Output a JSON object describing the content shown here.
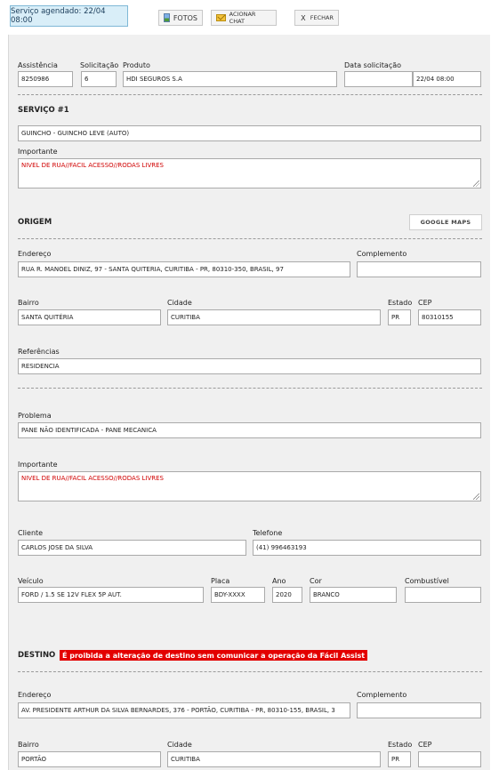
{
  "header": {
    "status": "Serviço agendado: 22/04 08:00",
    "fotos_label": "FOTOS",
    "chat_label": "ACIONAR CHAT",
    "fechar_label": "FECHAR",
    "fechar_glyph": "X"
  },
  "summary": {
    "assistencia_label": "Assistência",
    "assistencia_value": "8250986",
    "solicitacao_label": "Solicitação",
    "solicitacao_value": "6",
    "produto_label": "Produto",
    "produto_value": "HDI SEGUROS S.A",
    "data_label": "Data solicitação",
    "data_value_1": "",
    "data_value_2": "22/04 08:00"
  },
  "servico": {
    "title": "SERVIÇO #1",
    "tipo_value": "GUINCHO - GUINCHO LEVE (AUTO)",
    "importante_label": "Importante",
    "importante_value": "NIVEL DE RUA//FACIL ACESSO//RODAS LIVRES"
  },
  "origem": {
    "title": "ORIGEM",
    "maps_label": "GOOGLE MAPS",
    "endereco_label": "Endereço",
    "endereco_value": "RUA R. MANOEL DINIZ, 97 - SANTA QUITERIA, CURITIBA - PR, 80310-350, BRASIL, 97",
    "complemento_label": "Complemento",
    "complemento_value": "",
    "bairro_label": "Bairro",
    "bairro_value": "SANTA QUITÉRIA",
    "cidade_label": "Cidade",
    "cidade_value": "CURITIBA",
    "estado_label": "Estado",
    "estado_value": "PR",
    "cep_label": "CEP",
    "cep_value": "80310155",
    "referencias_label": "Referências",
    "referencias_value": "RESIDENCIA"
  },
  "problema": {
    "problema_label": "Problema",
    "problema_value": "PANE NÃO IDENTIFICADA - PANE MECANICA",
    "importante_label": "Importante",
    "importante_value": "NIVEL DE RUA//FACIL ACESSO//RODAS LIVRES",
    "cliente_label": "Cliente",
    "cliente_value": "CARLOS JOSE DA SILVA",
    "telefone_label": "Telefone",
    "telefone_value": "(41) 996463193",
    "veiculo_label": "Veículo",
    "veiculo_value": "FORD / 1.5 SE 12V FLEX 5P AUT.",
    "placa_label": "Placa",
    "placa_value": "BDY-XXXX",
    "ano_label": "Ano",
    "ano_value": "2020",
    "cor_label": "Cor",
    "cor_value": "BRANCO",
    "combustivel_label": "Combustível",
    "combustivel_value": ""
  },
  "destino": {
    "title": "DESTINO",
    "warning": "É proibida a alteração de destino sem comunicar a operação da Fácil Assist",
    "endereco_label": "Endereço",
    "endereco_value": "AV. PRESIDENTE ARTHUR DA SILVA BERNARDES, 376 - PORTÃO, CURITIBA - PR, 80310-155, BRASIL, 3",
    "complemento_label": "Complemento",
    "complemento_value": "",
    "bairro_label": "Bairro",
    "bairro_value": "PORTÃO",
    "cidade_label": "Cidade",
    "cidade_value": "CURITIBA",
    "estado_label": "Estado",
    "estado_value": "PR",
    "cep_label": "CEP",
    "cep_value": ""
  },
  "icons": {
    "fotos": "photo-icon",
    "chat": "envelope-icon",
    "fechar": "close-icon",
    "resize": "resize-grip-icon"
  }
}
